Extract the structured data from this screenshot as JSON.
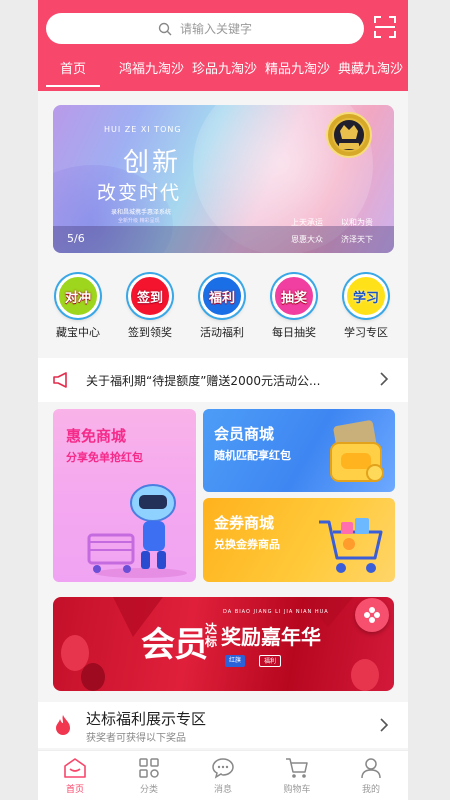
{
  "search": {
    "placeholder": "请输入关键字"
  },
  "tabs": [
    "首页",
    "鸿福九淘沙",
    "珍品九淘沙",
    "精品九淘沙",
    "典藏九淘沙"
  ],
  "banner": {
    "en": "HUI ZE XI TONG",
    "title1": "创新",
    "title2": "改变时代",
    "sub1": "录和昌城携手惠泽系统",
    "sub2": "全新升级 精彩呈现",
    "counter": "5/6",
    "slogans": [
      "上天承运",
      "以和为贵",
      "恩惠大众",
      "济泽天下"
    ]
  },
  "categories": [
    {
      "badge": "对冲",
      "label": "藏宝中心",
      "color": "#9dd61c"
    },
    {
      "badge": "签到",
      "label": "签到领奖",
      "color": "#f4142d"
    },
    {
      "badge": "福利",
      "label": "活动福利",
      "color": "#1b6fe6"
    },
    {
      "badge": "抽奖",
      "label": "每日抽奖",
      "color": "#f03fa0"
    },
    {
      "badge": "学习",
      "label": "学习专区",
      "color": "#ffe11a"
    }
  ],
  "notice": {
    "text": "关于福利期“待提额度”赠送2000元活动公..."
  },
  "cards": {
    "a": {
      "title": "惠免商城",
      "sub": "分享免单抢红包"
    },
    "b": {
      "title": "会员商城",
      "sub": "随机匹配享红包"
    },
    "c": {
      "title": "金券商城",
      "sub": "兑换金券商品"
    }
  },
  "promo": {
    "big": "会员",
    "dabiao": "达标",
    "right": "奖励嘉年华",
    "en": "DA BIAO JIANG LI JIA NIAN HUA",
    "pill1": "红旗",
    "pill2": "福利"
  },
  "section": {
    "title": "达标福利展示专区",
    "sub": "获奖者可获得以下奖品"
  },
  "nav": [
    "首页",
    "分类",
    "消息",
    "购物车",
    "我的"
  ],
  "colors": {
    "brand": "#f7476b",
    "accent_blue": "#3aa7e6"
  }
}
